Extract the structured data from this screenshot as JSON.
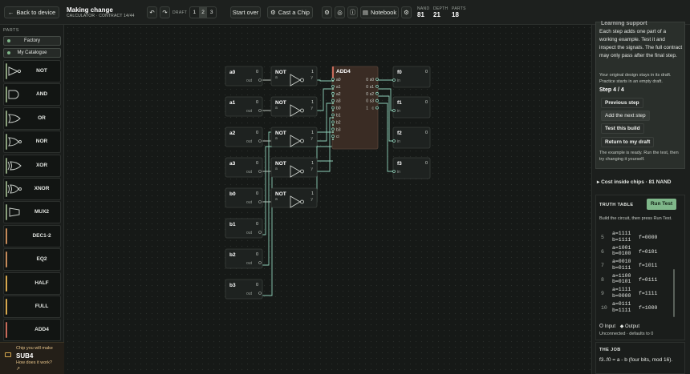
{
  "topbar": {
    "back_label": "Back to device",
    "title": "Making change",
    "subtitle": "CALCULATOR · CONTRACT 14/44",
    "undo_icon": "undo-icon",
    "redo_icon": "redo-icon",
    "draft_label": "DRAFT",
    "drafts": [
      "1",
      "2",
      "3"
    ],
    "start_over": "Start over",
    "cast_chip": "Cast a Chip",
    "notebook": "Notebook",
    "stats": [
      {
        "k": "NAND",
        "v": "81"
      },
      {
        "k": "DEPTH",
        "v": "21"
      },
      {
        "k": "PARTS",
        "v": "18"
      }
    ]
  },
  "sidebar": {
    "heading": "PARTS",
    "catalogues": [
      "Factory",
      "My Catalogue"
    ],
    "parts": [
      {
        "label": "NOT",
        "icon": "not-gate-icon",
        "color": "#8aa07c"
      },
      {
        "label": "AND",
        "icon": "and-gate-icon",
        "color": "#8aa07c"
      },
      {
        "label": "OR",
        "icon": "or-gate-icon",
        "color": "#8aa07c"
      },
      {
        "label": "NOR",
        "icon": "nor-gate-icon",
        "color": "#8aa07c"
      },
      {
        "label": "XOR",
        "icon": "xor-gate-icon",
        "color": "#8aa07c"
      },
      {
        "label": "XNOR",
        "icon": "xnor-gate-icon",
        "color": "#8aa07c"
      },
      {
        "label": "MUX2",
        "icon": "mux-icon",
        "color": "#8aa07c"
      },
      {
        "label": "DEC1-2",
        "icon": "",
        "color": "#c58a5a"
      },
      {
        "label": "EQ2",
        "icon": "",
        "color": "#c58a5a"
      },
      {
        "label": "HALF",
        "icon": "",
        "color": "#d7a84e"
      },
      {
        "label": "FULL",
        "icon": "",
        "color": "#d7a84e"
      },
      {
        "label": "ADD4",
        "icon": "",
        "color": "#c86a5a"
      }
    ],
    "make": {
      "label": "Chip you will make",
      "chip": "SUB4",
      "help": "How does it work?"
    }
  },
  "canvas": {
    "inputs": [
      {
        "name": "a0",
        "val": "0"
      },
      {
        "name": "a1",
        "val": "0"
      },
      {
        "name": "a2",
        "val": "0"
      },
      {
        "name": "a3",
        "val": "0"
      },
      {
        "name": "b0",
        "val": "0"
      },
      {
        "name": "b1",
        "val": "0"
      },
      {
        "name": "b2",
        "val": "0"
      },
      {
        "name": "b3",
        "val": "0"
      }
    ],
    "out_label": "out",
    "nots": [
      {
        "name": "NOT",
        "val": "1"
      },
      {
        "name": "NOT",
        "val": "1"
      },
      {
        "name": "NOT",
        "val": "1"
      },
      {
        "name": "NOT",
        "val": "1"
      },
      {
        "name": "NOT",
        "val": "1"
      }
    ],
    "not_pins": {
      "in": "a",
      "out": "y"
    },
    "adder": {
      "name": "ADD4",
      "inputs": [
        "a0",
        "a1",
        "a2",
        "a3",
        "b0",
        "b1",
        "b2",
        "b3",
        "ci"
      ],
      "outputs": [
        "s0",
        "s1",
        "s2",
        "s3",
        "c"
      ],
      "out_vals": [
        "0",
        "0",
        "0",
        "0",
        "1"
      ]
    },
    "outputs": [
      {
        "name": "f0",
        "val": "0"
      },
      {
        "name": "f1",
        "val": "0"
      },
      {
        "name": "f2",
        "val": "0"
      },
      {
        "name": "f3",
        "val": "0"
      }
    ],
    "in_label": "in"
  },
  "rightpanel": {
    "tip_heading": "Learning support",
    "tip_text": "Each step adds one part of a working example. Test it and inspect the signals. The full contract may only pass after the final step.",
    "tip_note": "Your original design stays in its draft. Practice starts in an empty draft.",
    "step": "Step 4 / 4",
    "buttons": [
      "Previous step",
      "Add the next step",
      "Test this build",
      "Return to my draft"
    ],
    "ready": "The example is ready. Run the test, then try changing it yourself.",
    "cost": "Cost inside chips · 81 NAND",
    "tt_heading": "TRUTH TABLE",
    "run_test": "Run Test",
    "tt_hint": "Build the circuit, then press Run Test.",
    "rows": [
      {
        "n": "5",
        "a": "a=1111",
        "b": "b=1111",
        "f": "f=0000"
      },
      {
        "n": "6",
        "a": "a=1001",
        "b": "b=0100",
        "f": "f=0101"
      },
      {
        "n": "7",
        "a": "a=0010",
        "b": "b=0111",
        "f": "f=1011"
      },
      {
        "n": "8",
        "a": "a=1100",
        "b": "b=0101",
        "f": "f=0111"
      },
      {
        "n": "9",
        "a": "a=1111",
        "b": "b=0000",
        "f": "f=1111"
      },
      {
        "n": "10",
        "a": "a=0111",
        "b": "b=1111",
        "f": "f=1000"
      }
    ],
    "legend_in": "Input",
    "legend_out": "Output",
    "unconnected": "Unconnected · defaults to 0",
    "job_heading": "THE JOB",
    "job": "f3..f0 = a - b (four bits, mod 16)."
  }
}
